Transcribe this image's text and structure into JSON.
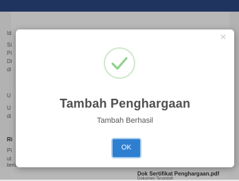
{
  "background": {
    "left_snippets": [
      "Id",
      "Si",
      "Pi",
      "Di",
      "di",
      "U",
      "U",
      "di",
      "Ri",
      "Pi",
      "ut"
    ],
    "bottom_left": "berlaku",
    "bottom_right_title": "Dok Sertifikat Penghargaan.pdf",
    "bottom_right_sub": "Dokumen Terunduh"
  },
  "modal": {
    "close_label": "×",
    "title": "Tambah Penghargaan",
    "message": "Tambah Berhasil",
    "ok_label": "OK",
    "icon_name": "success-check-icon",
    "success_color": "#8fd18b"
  }
}
